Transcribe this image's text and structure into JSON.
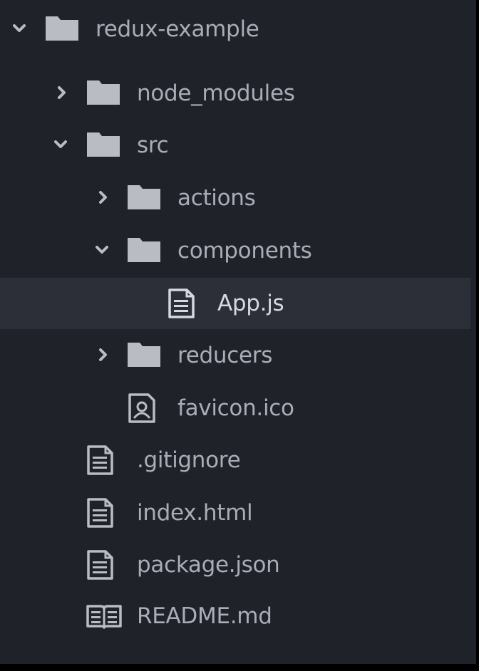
{
  "file_tree": {
    "root": {
      "label": "redux-example",
      "expanded": true
    },
    "items": [
      {
        "label": "node_modules",
        "type": "folder",
        "expanded": false
      },
      {
        "label": "src",
        "type": "folder",
        "expanded": true
      },
      {
        "label": "actions",
        "type": "folder",
        "expanded": false
      },
      {
        "label": "components",
        "type": "folder",
        "expanded": true
      },
      {
        "label": "App.js",
        "type": "file",
        "selected": true
      },
      {
        "label": "reducers",
        "type": "folder",
        "expanded": false
      },
      {
        "label": "favicon.ico",
        "type": "image-file"
      },
      {
        "label": ".gitignore",
        "type": "file"
      },
      {
        "label": "index.html",
        "type": "file"
      },
      {
        "label": "package.json",
        "type": "file"
      },
      {
        "label": "README.md",
        "type": "book-file"
      }
    ]
  },
  "colors": {
    "background": "#20222a",
    "selected_row": "#2c2f38",
    "text": "#a9adb7",
    "text_selected": "#d6d9df",
    "icon": "#b9bcc3"
  }
}
